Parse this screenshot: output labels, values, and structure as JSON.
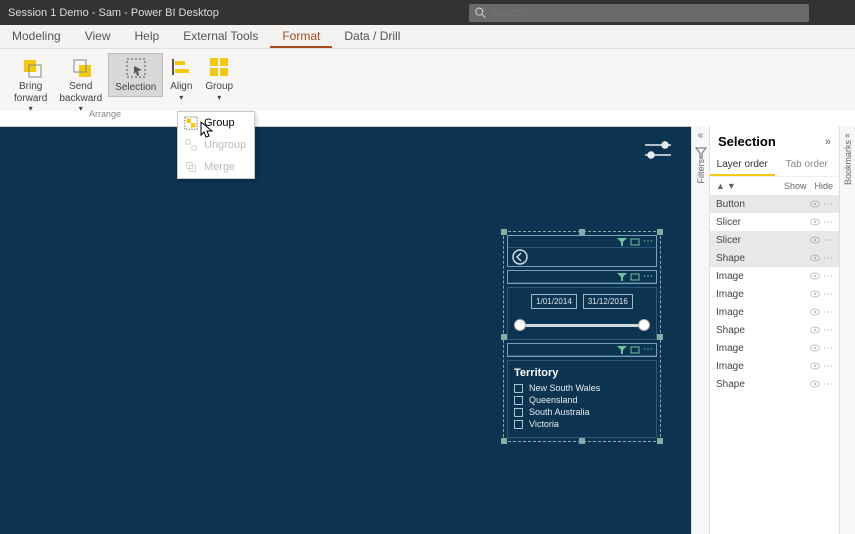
{
  "window": {
    "title": "Session 1 Demo - Sam - Power BI Desktop"
  },
  "search": {
    "placeholder": "Search"
  },
  "tabs": [
    {
      "label": "Modeling"
    },
    {
      "label": "View"
    },
    {
      "label": "Help"
    },
    {
      "label": "External Tools"
    },
    {
      "label": "Format",
      "active": true
    },
    {
      "label": "Data / Drill"
    }
  ],
  "ribbon": {
    "bring_forward": "Bring\nforward",
    "send_backward": "Send\nbackward",
    "selection": "Selection",
    "align": "Align",
    "group": "Group",
    "arrange": "Arrange"
  },
  "group_menu": {
    "group": "Group",
    "ungroup": "Ungroup",
    "merge": "Merge"
  },
  "filters_label": "Filters",
  "bookmarks_label": "Bookmarks",
  "selection_pane": {
    "title": "Selection",
    "tabs": {
      "layer": "Layer order",
      "tab": "Tab order"
    },
    "show": "Show",
    "hide": "Hide",
    "items": [
      {
        "label": "Button",
        "selected": true
      },
      {
        "label": "Slicer",
        "selected": false
      },
      {
        "label": "Slicer",
        "selected": true
      },
      {
        "label": "Shape",
        "selected": true
      },
      {
        "label": "Image",
        "selected": false
      },
      {
        "label": "Image",
        "selected": false
      },
      {
        "label": "Image",
        "selected": false
      },
      {
        "label": "Shape",
        "selected": false
      },
      {
        "label": "Image",
        "selected": false
      },
      {
        "label": "Image",
        "selected": false
      },
      {
        "label": "Shape",
        "selected": false
      }
    ]
  },
  "date_slicer": {
    "from": "1/01/2014",
    "to": "31/12/2016"
  },
  "territory": {
    "title": "Territory",
    "items": [
      {
        "label": "New South Wales"
      },
      {
        "label": "Queensland"
      },
      {
        "label": "South Australia"
      },
      {
        "label": "Victoria"
      }
    ]
  }
}
